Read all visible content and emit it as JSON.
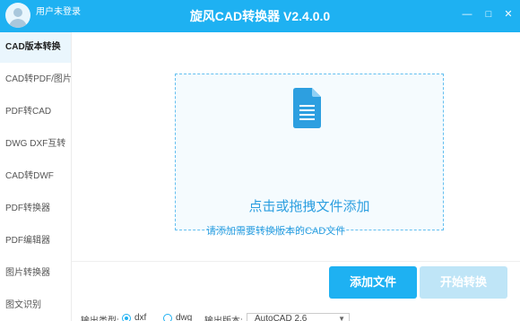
{
  "titlebar": {
    "login_text": "用户未登录",
    "app_title": "旋风CAD转换器 V2.4.0.0",
    "min_symbol": "—",
    "max_symbol": "□",
    "close_symbol": "✕"
  },
  "sidebar": {
    "items": [
      {
        "label": "CAD版本转换",
        "active": true
      },
      {
        "label": "CAD转PDF/图片",
        "active": false
      },
      {
        "label": "PDF转CAD",
        "active": false
      },
      {
        "label": "DWG DXF互转",
        "active": false
      },
      {
        "label": "CAD转DWF",
        "active": false
      },
      {
        "label": "PDF转换器",
        "active": false
      },
      {
        "label": "PDF编辑器",
        "active": false
      },
      {
        "label": "图片转换器",
        "active": false
      },
      {
        "label": "图文识别",
        "active": false
      }
    ]
  },
  "main": {
    "dropzone_text": "点击或拖拽文件添加",
    "hint_link": "请添加需要转换版本的CAD文件",
    "add_button": "添加文件",
    "start_button": "开始转换"
  },
  "options": {
    "output_type_label": "输出类型:",
    "type_dxf": "dxf",
    "type_dwg": "dwg",
    "output_version_label": "输出版本:",
    "version_value": "AutoCAD 2.6"
  },
  "colors": {
    "accent": "#1eb1f2",
    "link": "#2d9fe0",
    "disabled_button": "#bfe5f7"
  }
}
